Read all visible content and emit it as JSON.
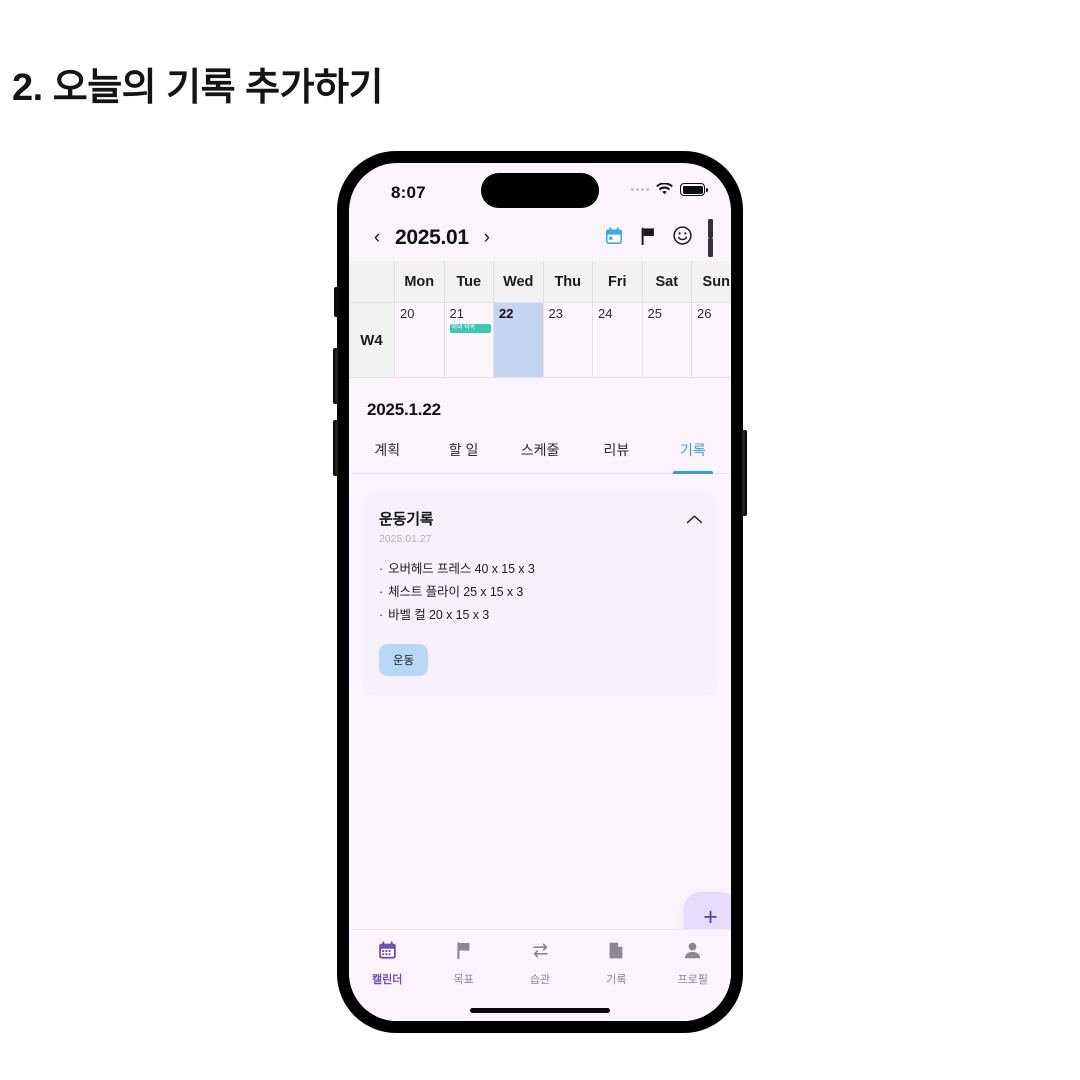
{
  "heading": "2. 오늘의 기록 추가하기",
  "status_bar": {
    "time": "8:07",
    "signal_icon": "signal-dots-icon",
    "wifi_icon": "wifi-icon",
    "battery_icon": "battery-icon"
  },
  "calendar_header": {
    "prev_label": "‹",
    "title": "2025.01",
    "next_label": "›",
    "actions": [
      {
        "name": "calendar-icon"
      },
      {
        "name": "flag-icon"
      },
      {
        "name": "smiley-icon"
      },
      {
        "name": "pause-icon"
      }
    ]
  },
  "calendar": {
    "week_label": "W4",
    "weekdays": [
      "Mon",
      "Tue",
      "Wed",
      "Thu",
      "Fri",
      "Sat",
      "Sun"
    ],
    "days": [
      {
        "num": "20",
        "selected": false,
        "event": null
      },
      {
        "num": "21",
        "selected": false,
        "event": "저녁 약속"
      },
      {
        "num": "22",
        "selected": true,
        "event": null
      },
      {
        "num": "23",
        "selected": false,
        "event": null
      },
      {
        "num": "24",
        "selected": false,
        "event": null
      },
      {
        "num": "25",
        "selected": false,
        "event": null
      },
      {
        "num": "26",
        "selected": false,
        "event": null
      }
    ],
    "event_color": "#3cc9b0",
    "selected_color": "#c5d4f0"
  },
  "detail": {
    "date_label": "2025.1.22",
    "tabs": [
      {
        "label": "계획",
        "active": false
      },
      {
        "label": "할 일",
        "active": false
      },
      {
        "label": "스케줄",
        "active": false
      },
      {
        "label": "리뷰",
        "active": false
      },
      {
        "label": "기록",
        "active": true
      }
    ],
    "active_tab_color": "#2f9cf4"
  },
  "record_card": {
    "title": "운동기록",
    "date": "2025.01.27",
    "collapse_icon": "chevron-up-icon",
    "items": [
      "오버헤드 프레스 40 x 15 x 3",
      "체스트 플라이 25 x 15 x 3",
      "바벨 컬 20 x 15 x 3"
    ],
    "tag": "운동",
    "tag_color": "#b9d8f6"
  },
  "fab": {
    "label": "+",
    "icon": "plus-icon",
    "color": "#e6dcfb"
  },
  "bottom_nav": {
    "items": [
      {
        "label": "캘린더",
        "icon": "calendar-icon",
        "active": true
      },
      {
        "label": "목표",
        "icon": "flag-icon",
        "active": false
      },
      {
        "label": "습관",
        "icon": "repeat-icon",
        "active": false
      },
      {
        "label": "기록",
        "icon": "document-icon",
        "active": false
      },
      {
        "label": "프로필",
        "icon": "person-icon",
        "active": false
      }
    ],
    "active_color": "#6d4fb8"
  }
}
